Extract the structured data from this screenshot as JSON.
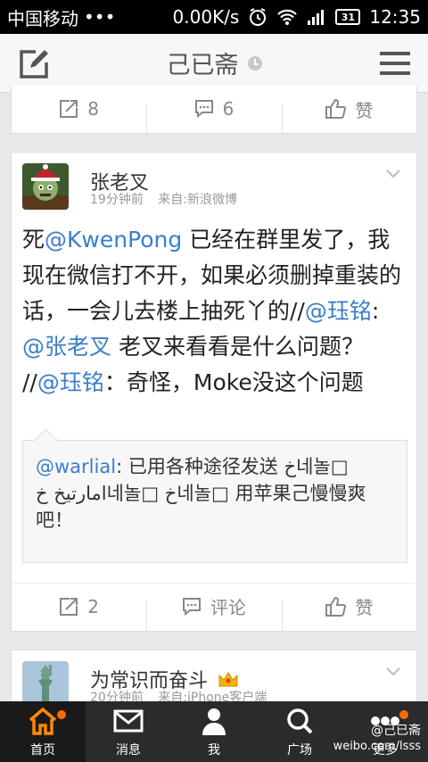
{
  "status_bar": {
    "carrier": "中国移动",
    "dots": "•••",
    "speed": "0.00K/s",
    "battery": "31",
    "time": "12:35"
  },
  "header": {
    "title": "己已斋",
    "icons": [
      "compose-icon",
      "clock-icon",
      "menu-icon"
    ]
  },
  "post1": {
    "repost_count": "8",
    "comment_count": "6",
    "like_label": "赞"
  },
  "post2": {
    "author": "张老叉",
    "time": "19分钟前",
    "source": "来自:新浪微博",
    "text": {
      "p1": "死",
      "m1": "@KwenPong",
      "p2": " 已经在群里发了，我现在微信打不开，如果必须删掉重装的话，一会儿去楼上抽死丫的//",
      "m2": "@珏铭",
      "p3": ": ",
      "m3": "@张老叉",
      "p4": " 老叉来看看是什么问题？ //",
      "m4": "@珏铭",
      "p5": "：奇怪，Moke没这个问题"
    },
    "quote": {
      "mention": "@warlial",
      "text": ": 已用各种途径发送 ﺥ네놀□ ﺍﻣﺎﺭﺗﻴﺦ ﺥ네놀□ ﺥ네놀□ 用苹果己慢慢爽吧！"
    },
    "repost_count": "2",
    "comment_label": "评论",
    "like_label": "赞"
  },
  "post3": {
    "author": "为常识而奋斗",
    "time": "20分钟前",
    "source": "来自:iPhone客户端"
  },
  "tabs": [
    {
      "label": "首页",
      "icon": "home-icon"
    },
    {
      "label": "消息",
      "icon": "mail-icon"
    },
    {
      "label": "我",
      "icon": "person-icon"
    },
    {
      "label": "广场",
      "icon": "search-icon"
    },
    {
      "label": "更多",
      "icon": "more-icon"
    }
  ],
  "watermark": {
    "line1": "@己已斋",
    "line2": "weibo.com/lsss"
  },
  "colors": {
    "mention": "#3b7ec8",
    "badge": "#ff6a00",
    "tabbar": "#2b2b2b"
  }
}
